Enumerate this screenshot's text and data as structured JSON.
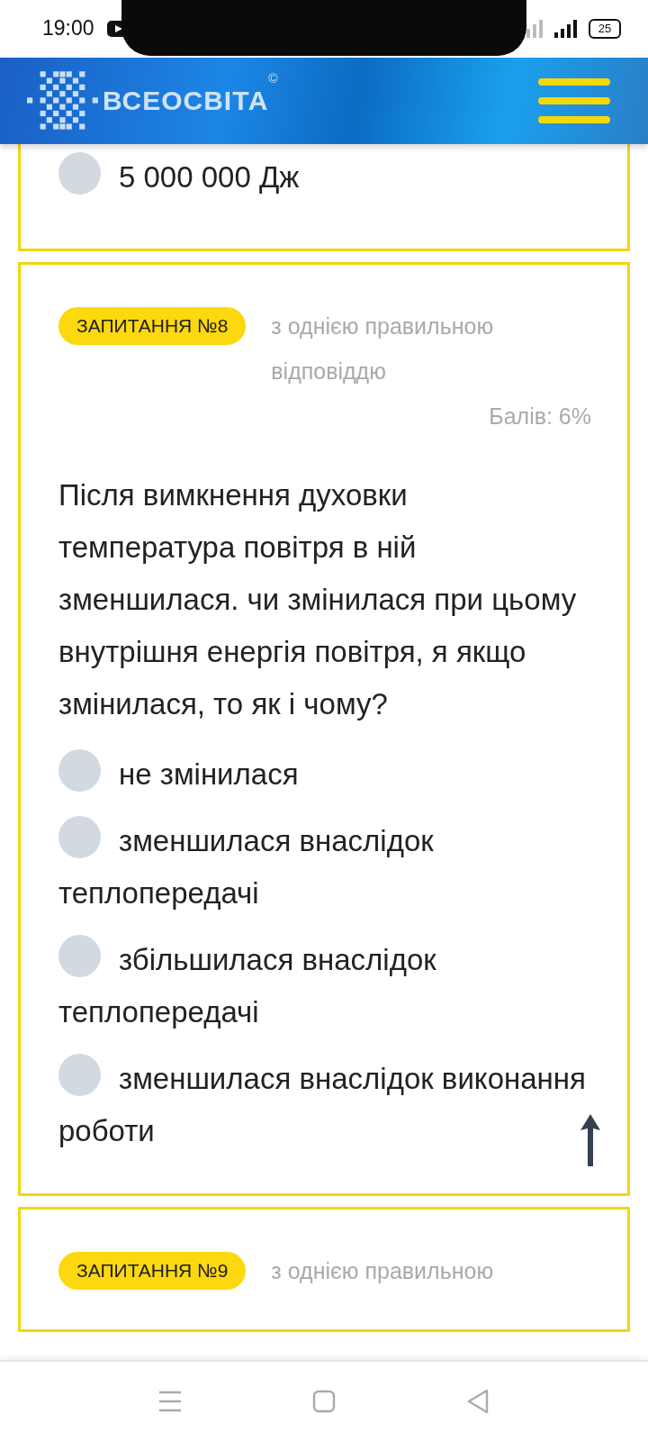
{
  "status_bar": {
    "time": "19:00",
    "battery": "25"
  },
  "header": {
    "logo": "ВСЕОСВІТА",
    "logo_mark": "©"
  },
  "questions": [
    {
      "options": [
        {
          "text": "5 000 000 Дж",
          "selected": false
        }
      ]
    },
    {
      "badge": "ЗАПИТАННЯ №8",
      "type": "з однією правильною відповіддю",
      "score": "Балів: 6%",
      "text": "Після вимкнення духовки температура повітря в ній зменшилася. чи змінилася при цьому внутрішня енергія повітря, я якщо змінилася, то як і чому?",
      "options": [
        {
          "text": "не змінилася",
          "selected": false
        },
        {
          "text": "зменшилася внаслідок теплопередачі",
          "selected": false
        },
        {
          "text": "збільшилася внаслідок теплопередачі",
          "selected": false
        },
        {
          "text": "зменшилася внаслідок виконання роботи",
          "selected": false
        }
      ]
    },
    {
      "badge": "ЗАПИТАННЯ №9",
      "type": "з однією правильною"
    }
  ]
}
